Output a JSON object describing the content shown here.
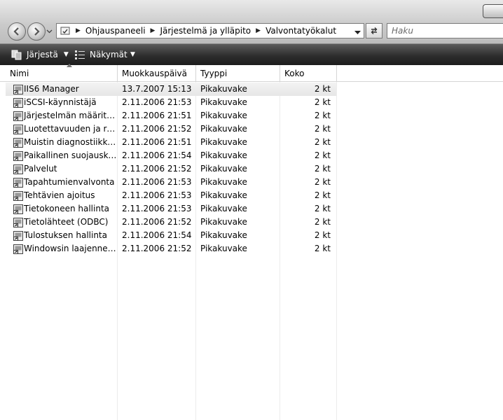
{
  "address": {
    "breadcrumbs": [
      "Ohjauspaneeli",
      "Järjestelmä ja ylläpito",
      "Valvontatyökalut"
    ],
    "separator": "▶"
  },
  "search": {
    "placeholder": "Haku"
  },
  "toolbar": {
    "organize_label": "Järjestä",
    "views_label": "Näkymät",
    "dropdown_glyph": "▼"
  },
  "columns": {
    "name": "Nimi",
    "modified": "Muokkauspäivä",
    "type": "Tyyppi",
    "size": "Koko"
  },
  "files": [
    {
      "name": "IIS6 Manager",
      "modified": "13.7.2007 15:13",
      "type": "Pikakuvake",
      "size": "2 kt",
      "icon": "iis-manager-icon"
    },
    {
      "name": "iSCSI-käynnistäjä",
      "modified": "2.11.2006 21:53",
      "type": "Pikakuvake",
      "size": "2 kt",
      "icon": "iscsi-icon"
    },
    {
      "name": "Järjestelmän määritykset",
      "modified": "2.11.2006 21:51",
      "type": "Pikakuvake",
      "size": "2 kt",
      "icon": "system-config-icon"
    },
    {
      "name": "Luotettavuuden ja resu...",
      "modified": "2.11.2006 21:52",
      "type": "Pikakuvake",
      "size": "2 kt",
      "icon": "reliability-monitor-icon"
    },
    {
      "name": "Muistin diagnostiikkat...",
      "modified": "2.11.2006 21:51",
      "type": "Pikakuvake",
      "size": "2 kt",
      "icon": "memory-diagnostics-icon"
    },
    {
      "name": "Paikallinen suojauskäy...",
      "modified": "2.11.2006 21:54",
      "type": "Pikakuvake",
      "size": "2 kt",
      "icon": "local-security-policy-icon"
    },
    {
      "name": "Palvelut",
      "modified": "2.11.2006 21:52",
      "type": "Pikakuvake",
      "size": "2 kt",
      "icon": "services-gear-icon"
    },
    {
      "name": "Tapahtumienvalvonta",
      "modified": "2.11.2006 21:53",
      "type": "Pikakuvake",
      "size": "2 kt",
      "icon": "event-viewer-icon"
    },
    {
      "name": "Tehtävien ajoitus",
      "modified": "2.11.2006 21:53",
      "type": "Pikakuvake",
      "size": "2 kt",
      "icon": "task-scheduler-icon"
    },
    {
      "name": "Tietokoneen hallinta",
      "modified": "2.11.2006 21:53",
      "type": "Pikakuvake",
      "size": "2 kt",
      "icon": "computer-management-icon"
    },
    {
      "name": "Tietolähteet (ODBC)",
      "modified": "2.11.2006 21:52",
      "type": "Pikakuvake",
      "size": "2 kt",
      "icon": "odbc-data-sources-icon"
    },
    {
      "name": "Tulostuksen hallinta",
      "modified": "2.11.2006 21:54",
      "type": "Pikakuvake",
      "size": "2 kt",
      "icon": "print-management-icon"
    },
    {
      "name": "Windowsin laajennettu...",
      "modified": "2.11.2006 21:52",
      "type": "Pikakuvake",
      "size": "2 kt",
      "icon": "windows-firewall-icon"
    }
  ]
}
